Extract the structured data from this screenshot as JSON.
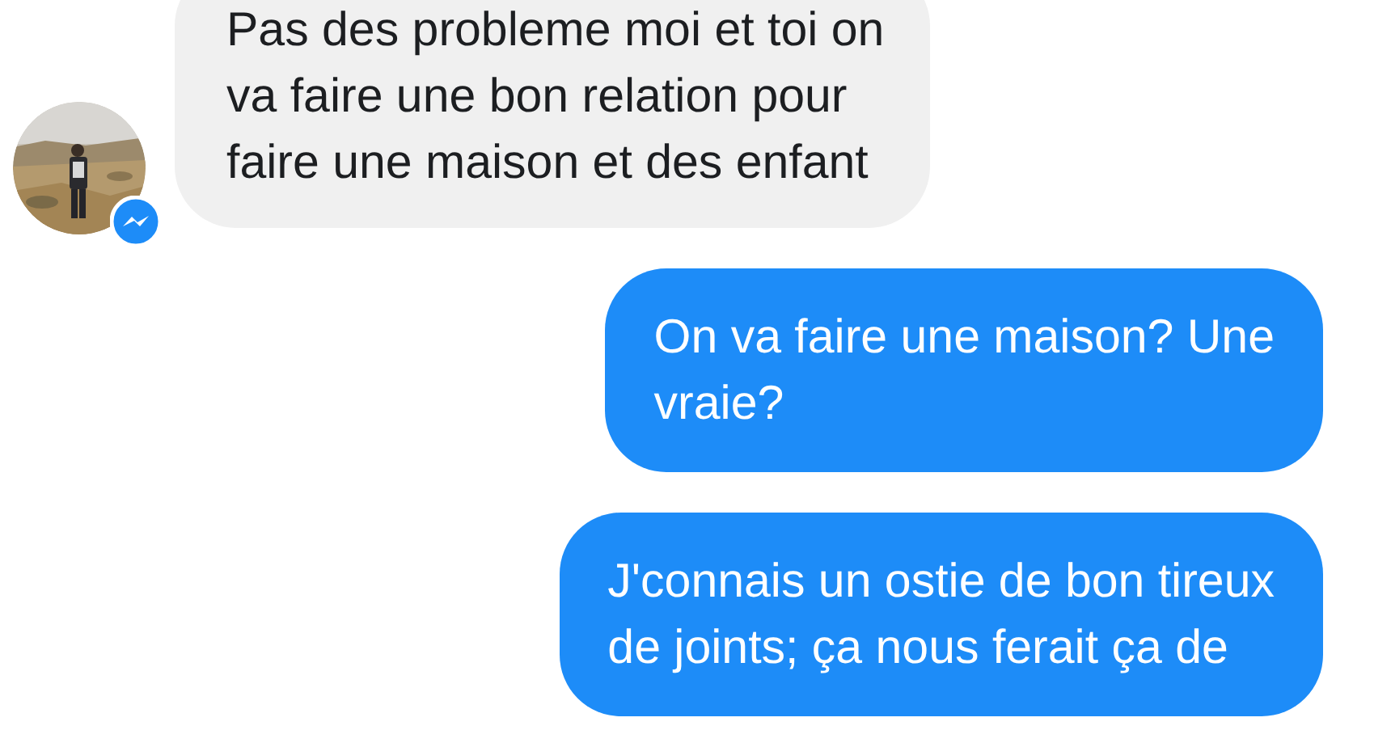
{
  "messages": [
    {
      "kind": "incoming",
      "lines": [
        "Pas des probleme moi et toi on",
        "va faire une bon relation pour",
        "faire une maison et des enfant"
      ]
    },
    {
      "kind": "outgoing",
      "lines": [
        "On va faire une maison? Une",
        "vraie?"
      ]
    },
    {
      "kind": "outgoing",
      "lines": [
        "J'connais un ostie de bon tireux",
        "de joints; ça nous ferait ça de"
      ]
    }
  ]
}
